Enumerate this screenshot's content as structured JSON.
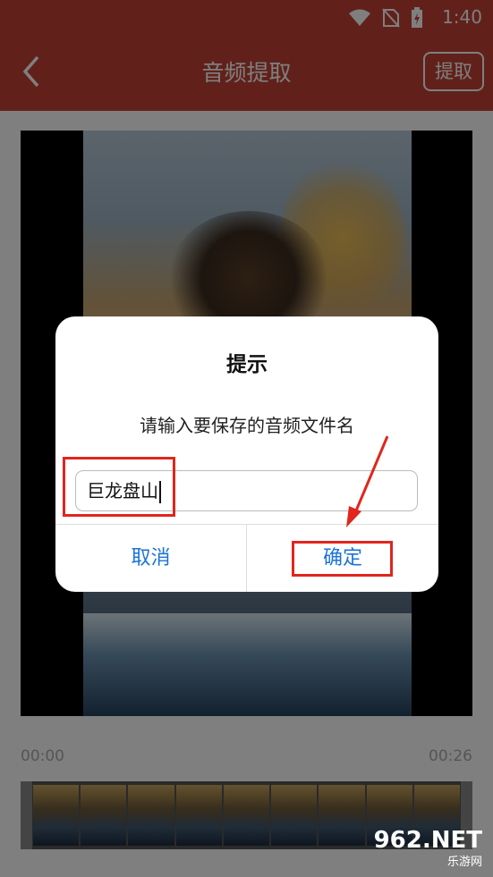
{
  "status": {
    "time": "1:40"
  },
  "header": {
    "title": "音频提取",
    "extract_label": "提取"
  },
  "player": {
    "time_start": "00:00",
    "time_end": "00:26"
  },
  "dialog": {
    "title": "提示",
    "message": "请输入要保存的音频文件名",
    "input_value": "巨龙盘山",
    "cancel_label": "取消",
    "ok_label": "确定"
  },
  "watermark": {
    "main": "962.NET",
    "sub": "乐游网"
  },
  "colors": {
    "header": "#c24335",
    "button_blue": "#1b73d8",
    "annotation_red": "#e0261e"
  }
}
